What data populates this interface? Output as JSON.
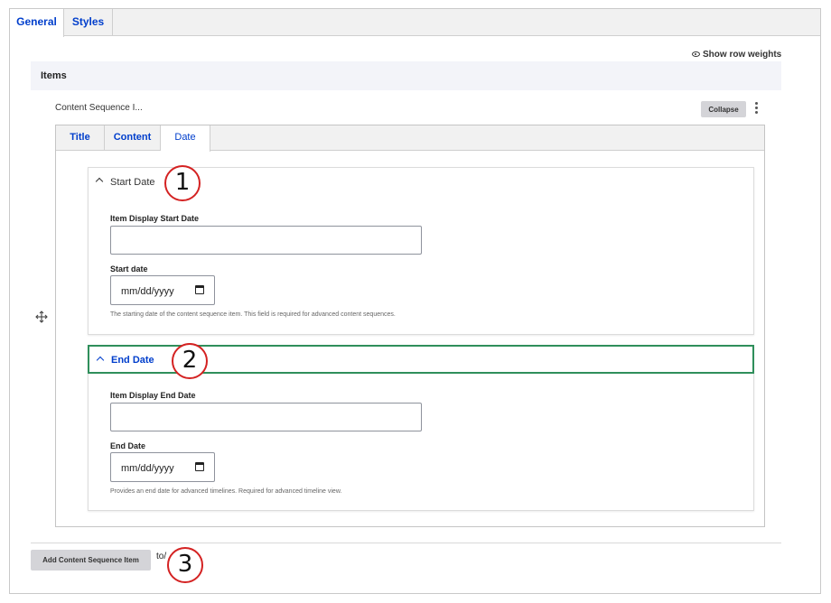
{
  "top_tabs": [
    {
      "label": "General",
      "active": true
    },
    {
      "label": "Styles",
      "active": false
    }
  ],
  "show_row_weights": "Show row weights",
  "items": {
    "title": "Items",
    "sequence_label": "Content Sequence I...",
    "collapse_label": "Collapse",
    "inner_tabs": [
      {
        "label": "Title",
        "active": false
      },
      {
        "label": "Content",
        "active": false
      },
      {
        "label": "Date",
        "active": true
      }
    ],
    "start_section": {
      "title": "Start Date",
      "display_label": "Item Display Start Date",
      "display_value": "",
      "date_label": "Start date",
      "date_placeholder": "mm/dd/yyyy",
      "description": "The starting date of the content sequence item. This field is required for advanced content sequences."
    },
    "end_section": {
      "title": "End Date",
      "display_label": "Item Display End Date",
      "display_value": "",
      "date_label": "End Date",
      "date_placeholder": "mm/dd/yyyy",
      "description": "Provides an end date for advanced timelines. Required for advanced timeline view."
    }
  },
  "add_button_label": "Add Content Sequence Item",
  "to_text": "to/",
  "markers": [
    "1",
    "2",
    "3"
  ],
  "colors": {
    "link_blue": "#003ecc",
    "focus_green": "#2f8f5b",
    "marker_red": "#d42222"
  }
}
